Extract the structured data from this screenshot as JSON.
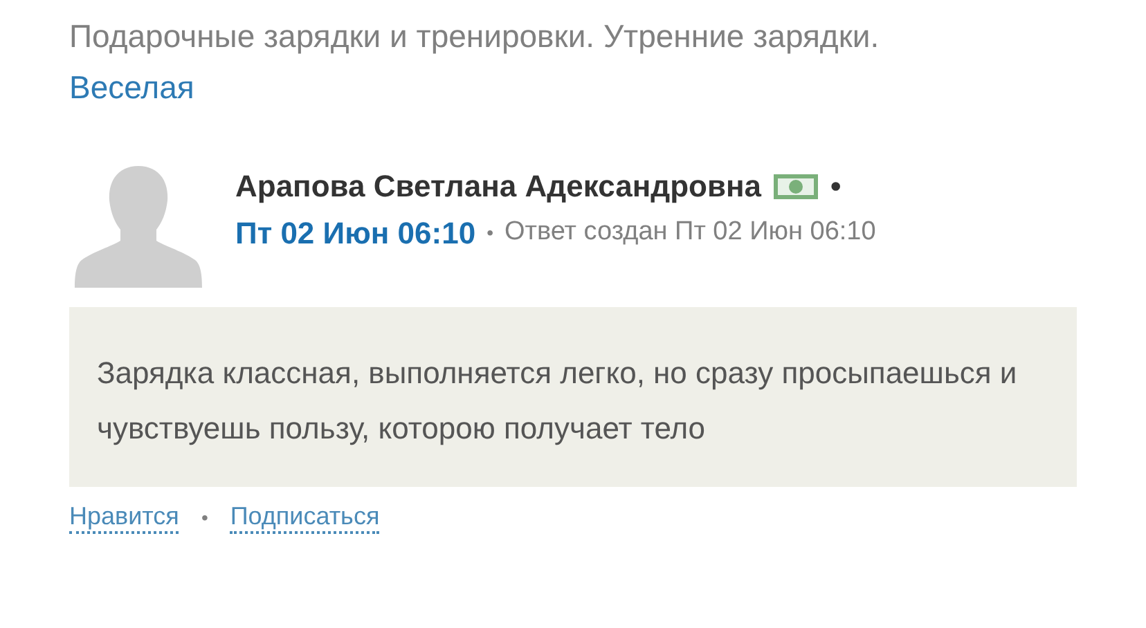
{
  "intro": {
    "text": "Подарочные зарядки и тренировки. Утренние зарядки.",
    "link": "Веселая"
  },
  "post": {
    "author": "Арапова Светлана Адександровна",
    "author_separator": "•",
    "date": "Пт 02 Июн 06:10",
    "meta_separator": "•",
    "meta": "Ответ создан Пт 02 Июн 06:10",
    "text": "Зарядка классная, выполняется легко, но сразу просыпаешься и чувствуешь пользу, которою получает тело"
  },
  "actions": [
    {
      "label": "Нравится"
    },
    {
      "label": "Подписаться"
    }
  ],
  "action_separator": "•"
}
